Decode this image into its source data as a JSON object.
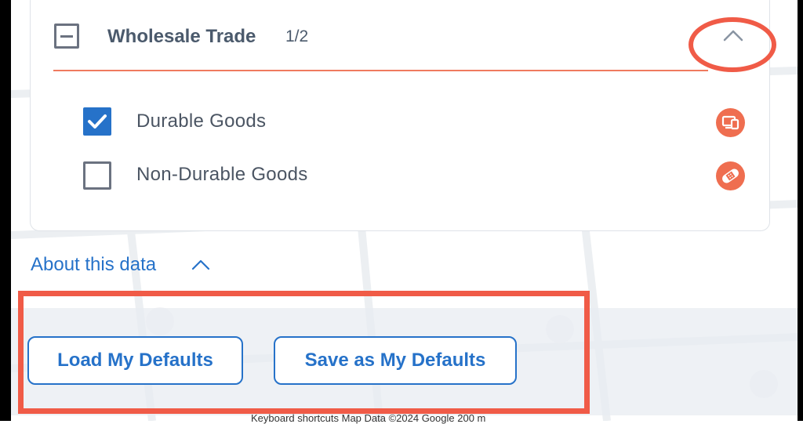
{
  "group": {
    "title": "Wholesale Trade",
    "count": "1/2"
  },
  "items": [
    {
      "label": "Durable Goods",
      "checked": true,
      "icon": "devices-icon"
    },
    {
      "label": "Non-Durable Goods",
      "checked": false,
      "icon": "bandage-icon"
    }
  ],
  "about": {
    "label": "About this data"
  },
  "buttons": {
    "load_label": "Load My Defaults",
    "save_label": "Save as My Defaults"
  },
  "map_attribution": "Keyboard shortcuts   Map Data ©2024 Google   200 m",
  "colors": {
    "accent": "#2672c9",
    "annotation": "#f05b47",
    "divider": "#ef7a5f",
    "category_icon": "#ef6e50"
  }
}
